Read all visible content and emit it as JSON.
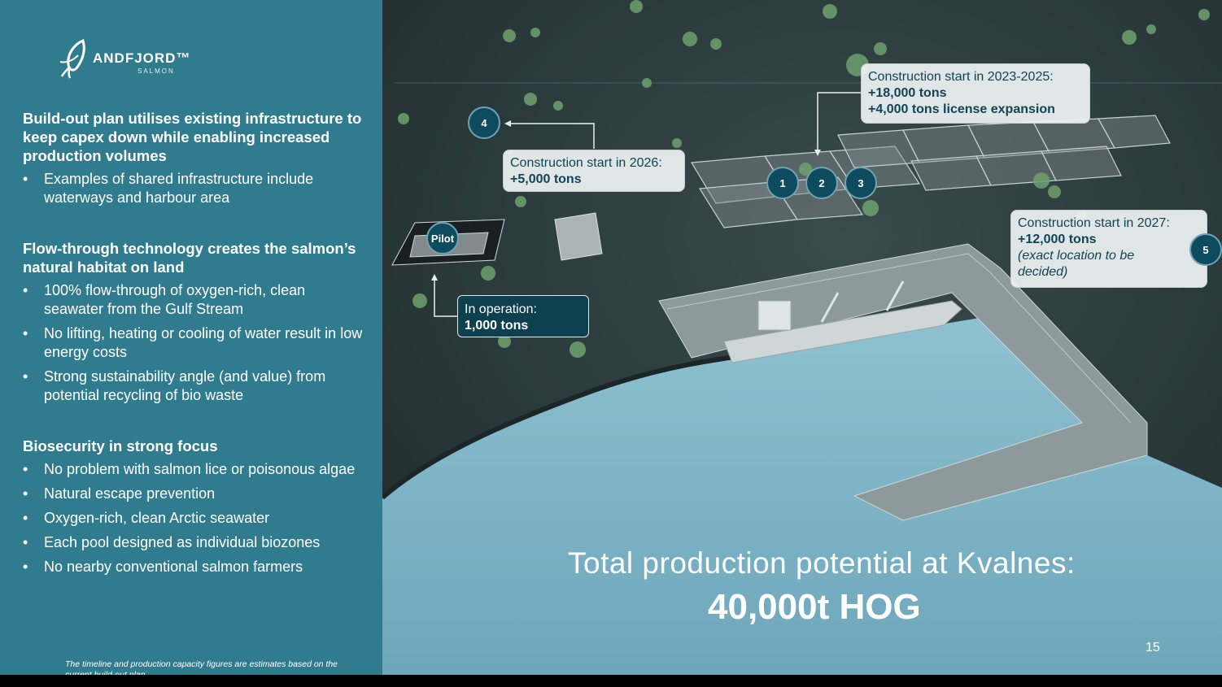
{
  "logo": {
    "brand": "ANDFJORD™",
    "sub": "SALMON"
  },
  "sections": [
    {
      "title": "Build-out plan utilises existing infrastructure to keep capex down while enabling increased production volumes",
      "bullets": [
        "Examples of shared infrastructure include waterways and harbour area"
      ]
    },
    {
      "title": "Flow-through technology creates the salmon’s natural habitat on land",
      "bullets": [
        "100% flow-through of oxygen-rich, clean seawater from the Gulf Stream",
        "No lifting, heating or cooling of water result in low energy costs",
        "Strong sustainability angle (and value) from potential recycling of bio waste"
      ]
    },
    {
      "title": "Biosecurity in strong focus",
      "bullets": [
        "No problem with salmon lice or poisonous algae",
        "Natural escape prevention",
        "Oxygen-rich, clean Arctic seawater",
        "Each pool designed as individual biozones",
        "No nearby conventional salmon farmers"
      ]
    }
  ],
  "footnote": "The timeline and production capacity figures are estimates based on the current build-out plan",
  "callouts": {
    "c2023": {
      "line1": "Construction start in 2023-2025:",
      "line2": "+18,000 tons",
      "line3": "+4,000 tons license expansion"
    },
    "c2026": {
      "line1": "Construction start in 2026:",
      "line2": "+5,000 tons"
    },
    "c2027": {
      "line1": "Construction start in 2027:",
      "line2": "+12,000 tons",
      "line3": "(exact location to be decided)"
    },
    "operation": {
      "line1": "In operation:",
      "line2": "1,000 tons"
    }
  },
  "badges": {
    "pilot": "Pilot",
    "b1": "1",
    "b2": "2",
    "b3": "3",
    "b4": "4",
    "b5": "5"
  },
  "total": {
    "line1": "Total production potential at Kvalnes:",
    "line2": "40,000t HOG"
  },
  "page_number": "15",
  "colors": {
    "panel": "#317b8e",
    "badge": "#0f4b5f",
    "land": "#2a3a3c",
    "water": "#7fb3c5"
  }
}
